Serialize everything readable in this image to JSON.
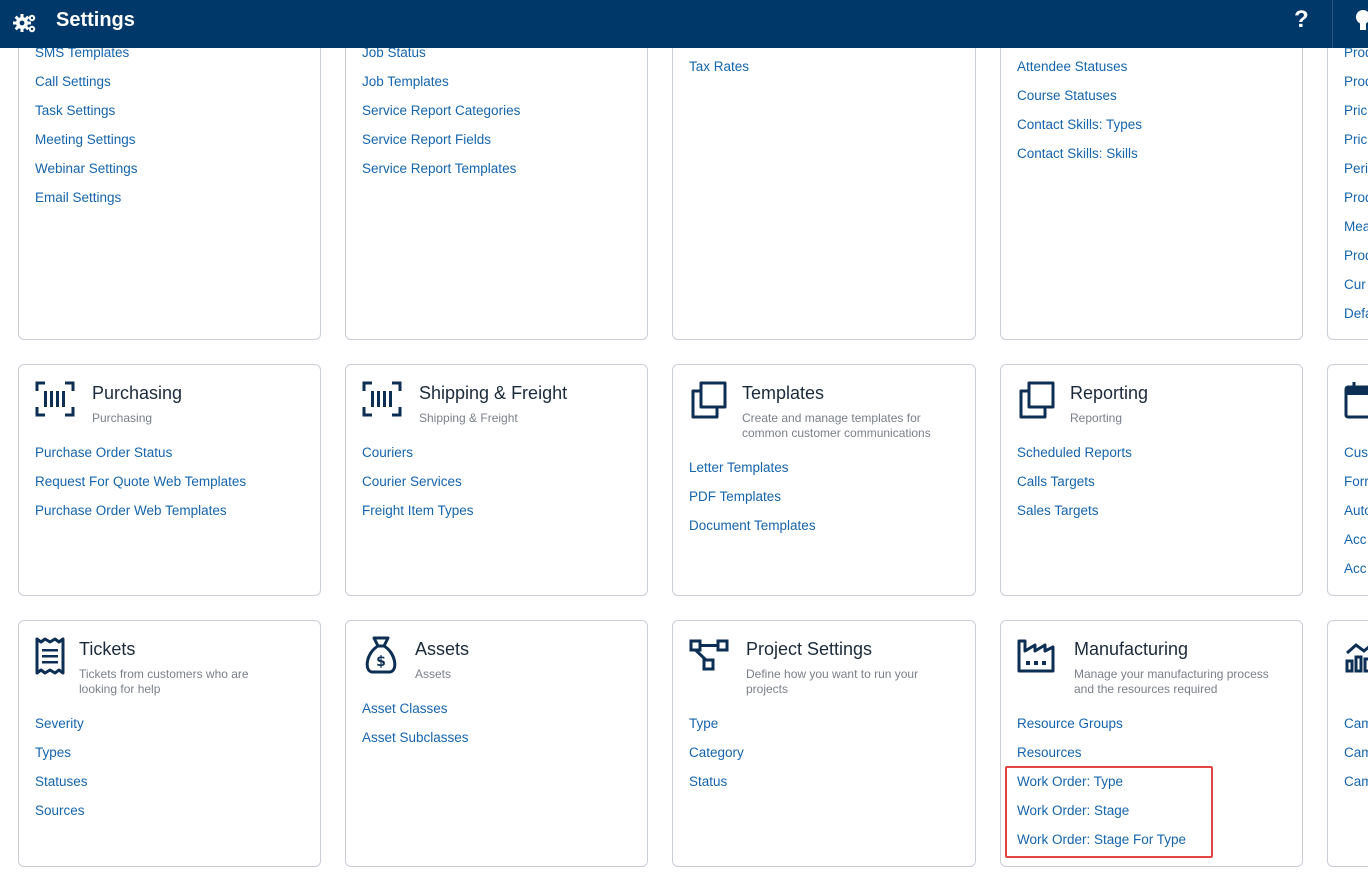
{
  "header": {
    "title": "Settings",
    "help": "?"
  },
  "row1": {
    "col1": {
      "links": [
        "SMS Templates",
        "Call Settings",
        "Task Settings",
        "Meeting Settings",
        "Webinar Settings",
        "Email Settings"
      ]
    },
    "col2": {
      "links": [
        "Job Status",
        "Job Templates",
        "Service Report Categories",
        "Service Report Fields",
        "Service Report Templates"
      ]
    },
    "col3": {
      "links": [
        "Tax Rates"
      ]
    },
    "col4": {
      "links": [
        "Attendee Statuses",
        "Course Statuses",
        "Contact Skills: Types",
        "Contact Skills: Skills"
      ]
    },
    "col5": {
      "links": [
        "Prod",
        "Prod",
        "Pric",
        "Pric",
        "Peri",
        "Prod",
        "Mea",
        "Prod",
        "Cur",
        "Defa"
      ]
    }
  },
  "row2": {
    "purchasing": {
      "name": "Purchasing",
      "desc": "Purchasing",
      "links": [
        "Purchase Order Status",
        "Request For Quote Web Templates",
        "Purchase Order Web Templates"
      ]
    },
    "shipping": {
      "name": "Shipping & Freight",
      "desc": "Shipping & Freight",
      "links": [
        "Couriers",
        "Courier Services",
        "Freight Item Types"
      ]
    },
    "templates": {
      "name": "Templates",
      "desc": "Create and manage templates for common customer communications",
      "links": [
        "Letter Templates",
        "PDF Templates",
        "Document Templates"
      ]
    },
    "reporting": {
      "name": "Reporting",
      "desc": "Reporting",
      "links": [
        "Scheduled Reports",
        "Calls Targets",
        "Sales Targets"
      ]
    },
    "col5": {
      "links": [
        "Cus",
        "Forr",
        "Auto",
        "Acc",
        "Acc"
      ]
    }
  },
  "row3": {
    "tickets": {
      "name": "Tickets",
      "desc": "Tickets from customers who are looking for help",
      "links": [
        "Severity",
        "Types",
        "Statuses",
        "Sources"
      ]
    },
    "assets": {
      "name": "Assets",
      "desc": "Assets",
      "links": [
        "Asset Classes",
        "Asset Subclasses"
      ]
    },
    "project": {
      "name": "Project Settings",
      "desc": "Define how you want to run your projects",
      "links": [
        "Type",
        "Category",
        "Status"
      ]
    },
    "manufacturing": {
      "name": "Manufacturing",
      "desc": "Manage your manufacturing process and the resources required",
      "links": [
        "Resource Groups",
        "Resources",
        "Work Order: Type",
        "Work Order: Stage",
        "Work Order: Stage For Type"
      ]
    },
    "col5": {
      "links": [
        "Cam",
        "Cam",
        "Cam"
      ]
    }
  },
  "colors": {
    "header_bg": "#003869",
    "link": "#1564ad",
    "icon": "#0d2f54",
    "highlight": "#e34545"
  }
}
